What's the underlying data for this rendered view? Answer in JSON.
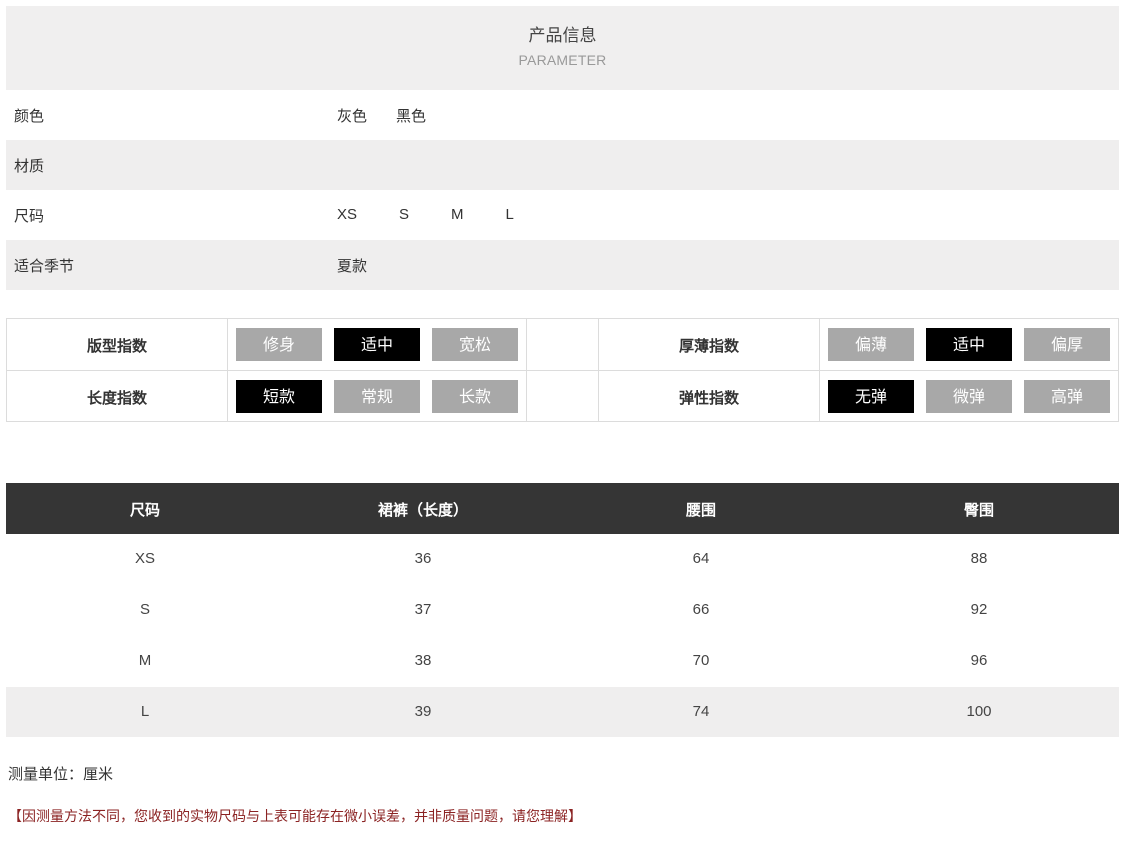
{
  "parameter": {
    "title": "产品信息",
    "subtitle": "PARAMETER",
    "rows": [
      {
        "label": "颜色",
        "values": [
          "灰色",
          "黑色"
        ]
      },
      {
        "label": "材质",
        "values": []
      },
      {
        "label": "尺码",
        "values": [
          "XS",
          "S",
          "M",
          "L"
        ]
      },
      {
        "label": "适合季节",
        "values": [
          "夏款"
        ]
      }
    ]
  },
  "indices": {
    "fit": {
      "label": "版型指数",
      "options": [
        "修身",
        "适中",
        "宽松"
      ],
      "selected": "适中"
    },
    "length": {
      "label": "长度指数",
      "options": [
        "短款",
        "常规",
        "长款"
      ],
      "selected": "短款"
    },
    "thickness": {
      "label": "厚薄指数",
      "options": [
        "偏薄",
        "适中",
        "偏厚"
      ],
      "selected": "适中"
    },
    "elasticity": {
      "label": "弹性指数",
      "options": [
        "无弹",
        "微弹",
        "高弹"
      ],
      "selected": "无弹"
    }
  },
  "size_table": {
    "headers": [
      "尺码",
      "裙裤（长度）",
      "腰围",
      "臀围"
    ],
    "rows": [
      [
        "XS",
        "36",
        "64",
        "88"
      ],
      [
        "S",
        "37",
        "66",
        "92"
      ],
      [
        "M",
        "38",
        "70",
        "96"
      ],
      [
        "L",
        "39",
        "74",
        "100"
      ]
    ]
  },
  "notes": {
    "unit": "测量单位：厘米",
    "disclaimer": "【因测量方法不同，您收到的实物尺码与上表可能存在微小误差，并非质量问题，请您理解】"
  },
  "colors": {
    "header_bg": "#f0efef",
    "chip_selected": "#000000",
    "chip_unselected": "#a8a8a8",
    "table_header_bg": "#353535",
    "disclaimer_text": "#8b2323"
  }
}
